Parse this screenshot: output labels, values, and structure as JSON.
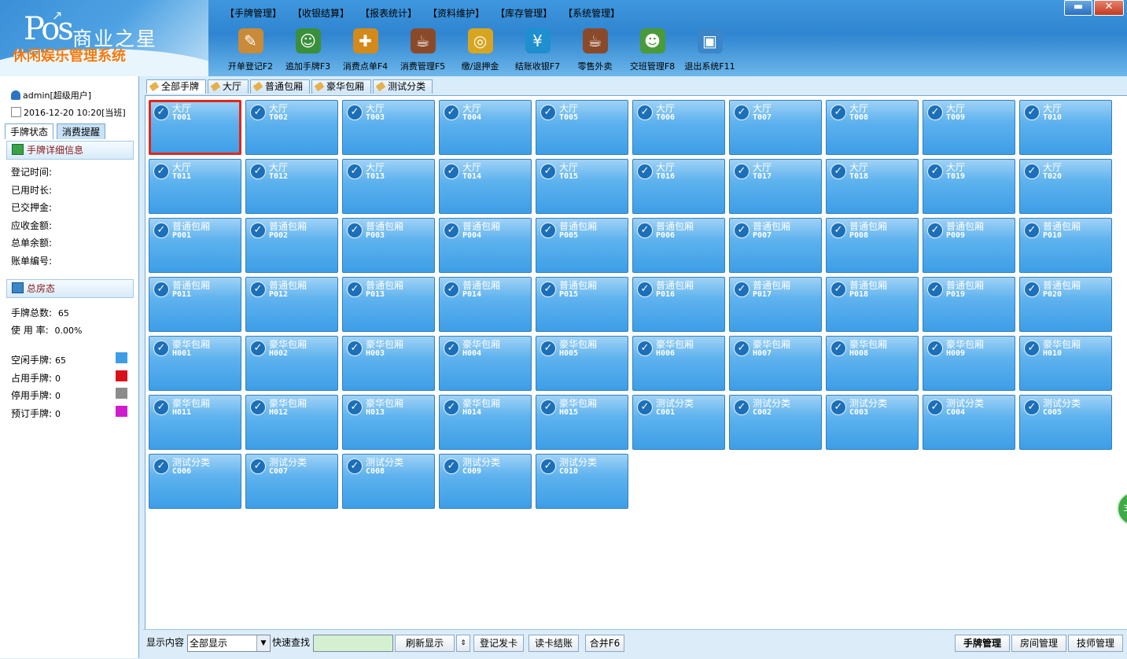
{
  "app": {
    "logo_text": "Pos",
    "brand": "商业之星",
    "subtitle": "休闲娱乐管理系统"
  },
  "menu": [
    "【手牌管理】",
    "【收银结算】",
    "【报表统计】",
    "【资料维护】",
    "【库存管理】",
    "【系统管理】"
  ],
  "toolbar": [
    {
      "label": "开单登记F2",
      "icon": "clipboard-icon",
      "color": "#c98a3a",
      "glyph": "✎"
    },
    {
      "label": "追加手牌F3",
      "icon": "user-icon",
      "color": "#3a8f3a",
      "glyph": "☺"
    },
    {
      "label": "消费点单F4",
      "icon": "cart-icon",
      "color": "#d48a1a",
      "glyph": "✚"
    },
    {
      "label": "消费管理F5",
      "icon": "coffee-cup-icon",
      "color": "#8a4a2a",
      "glyph": "☕"
    },
    {
      "label": "缴/退押金",
      "icon": "coins-icon",
      "color": "#d8a520",
      "glyph": "◎"
    },
    {
      "label": "结账收银F7",
      "icon": "yen-icon",
      "color": "#1f8fd0",
      "glyph": "¥"
    },
    {
      "label": "零售外卖",
      "icon": "coffee-cup-icon",
      "color": "#8a4a2a",
      "glyph": "☕"
    },
    {
      "label": "交班管理F8",
      "icon": "group-icon",
      "color": "#4a9a3a",
      "glyph": "☻"
    },
    {
      "label": "退出系统F11",
      "icon": "exit-window-icon",
      "color": "#3a86c8",
      "glyph": "▣"
    }
  ],
  "window_controls": {
    "minimize": "▬",
    "close": "✕"
  },
  "sidebar": {
    "user": "admin[超级用户]",
    "date": "2016-12-20 10:20[当班]",
    "tabs": [
      "手牌状态",
      "消费提醒"
    ],
    "detail_title": "手牌详细信息",
    "detail_fields": [
      "登记时间:",
      "已用时长:",
      "已交押金:",
      "应收金额:",
      "总单余额:",
      "账单编号:"
    ],
    "summary_title": "总房态",
    "total_label": "手牌总数:",
    "total_value": "65",
    "usage_label": "使 用 率:",
    "usage_value": "0.00%",
    "legend": [
      {
        "label": "空闲手牌:",
        "value": "65",
        "color": "#3d9ee6"
      },
      {
        "label": "占用手牌:",
        "value": "0",
        "color": "#d8121a"
      },
      {
        "label": "停用手牌:",
        "value": "0",
        "color": "#8c8c8c"
      },
      {
        "label": "预订手牌:",
        "value": "0",
        "color": "#d01ccf"
      }
    ]
  },
  "category_tabs": [
    "全部手牌",
    "大厅",
    "普通包厢",
    "豪华包厢",
    "测试分类"
  ],
  "cards": [
    {
      "cat": "大厅",
      "code": "T001"
    },
    {
      "cat": "大厅",
      "code": "T002"
    },
    {
      "cat": "大厅",
      "code": "T003"
    },
    {
      "cat": "大厅",
      "code": "T004"
    },
    {
      "cat": "大厅",
      "code": "T005"
    },
    {
      "cat": "大厅",
      "code": "T006"
    },
    {
      "cat": "大厅",
      "code": "T007"
    },
    {
      "cat": "大厅",
      "code": "T008"
    },
    {
      "cat": "大厅",
      "code": "T009"
    },
    {
      "cat": "大厅",
      "code": "T010"
    },
    {
      "cat": "大厅",
      "code": "T011"
    },
    {
      "cat": "大厅",
      "code": "T012"
    },
    {
      "cat": "大厅",
      "code": "T013"
    },
    {
      "cat": "大厅",
      "code": "T014"
    },
    {
      "cat": "大厅",
      "code": "T015"
    },
    {
      "cat": "大厅",
      "code": "T016"
    },
    {
      "cat": "大厅",
      "code": "T017"
    },
    {
      "cat": "大厅",
      "code": "T018"
    },
    {
      "cat": "大厅",
      "code": "T019"
    },
    {
      "cat": "大厅",
      "code": "T020"
    },
    {
      "cat": "普通包厢",
      "code": "P001"
    },
    {
      "cat": "普通包厢",
      "code": "P002"
    },
    {
      "cat": "普通包厢",
      "code": "P003"
    },
    {
      "cat": "普通包厢",
      "code": "P004"
    },
    {
      "cat": "普通包厢",
      "code": "P005"
    },
    {
      "cat": "普通包厢",
      "code": "P006"
    },
    {
      "cat": "普通包厢",
      "code": "P007"
    },
    {
      "cat": "普通包厢",
      "code": "P008"
    },
    {
      "cat": "普通包厢",
      "code": "P009"
    },
    {
      "cat": "普通包厢",
      "code": "P010"
    },
    {
      "cat": "普通包厢",
      "code": "P011"
    },
    {
      "cat": "普通包厢",
      "code": "P012"
    },
    {
      "cat": "普通包厢",
      "code": "P013"
    },
    {
      "cat": "普通包厢",
      "code": "P014"
    },
    {
      "cat": "普通包厢",
      "code": "P015"
    },
    {
      "cat": "普通包厢",
      "code": "P016"
    },
    {
      "cat": "普通包厢",
      "code": "P017"
    },
    {
      "cat": "普通包厢",
      "code": "P018"
    },
    {
      "cat": "普通包厢",
      "code": "P019"
    },
    {
      "cat": "普通包厢",
      "code": "P020"
    },
    {
      "cat": "豪华包厢",
      "code": "H001"
    },
    {
      "cat": "豪华包厢",
      "code": "H002"
    },
    {
      "cat": "豪华包厢",
      "code": "H003"
    },
    {
      "cat": "豪华包厢",
      "code": "H004"
    },
    {
      "cat": "豪华包厢",
      "code": "H005"
    },
    {
      "cat": "豪华包厢",
      "code": "H006"
    },
    {
      "cat": "豪华包厢",
      "code": "H007"
    },
    {
      "cat": "豪华包厢",
      "code": "H008"
    },
    {
      "cat": "豪华包厢",
      "code": "H009"
    },
    {
      "cat": "豪华包厢",
      "code": "H010"
    },
    {
      "cat": "豪华包厢",
      "code": "H011"
    },
    {
      "cat": "豪华包厢",
      "code": "H012"
    },
    {
      "cat": "豪华包厢",
      "code": "H013"
    },
    {
      "cat": "豪华包厢",
      "code": "H014"
    },
    {
      "cat": "豪华包厢",
      "code": "H015"
    },
    {
      "cat": "测试分类",
      "code": "C001"
    },
    {
      "cat": "测试分类",
      "code": "C002"
    },
    {
      "cat": "测试分类",
      "code": "C003"
    },
    {
      "cat": "测试分类",
      "code": "C004"
    },
    {
      "cat": "测试分类",
      "code": "C005"
    },
    {
      "cat": "测试分类",
      "code": "C006"
    },
    {
      "cat": "测试分类",
      "code": "C007"
    },
    {
      "cat": "测试分类",
      "code": "C008"
    },
    {
      "cat": "测试分类",
      "code": "C009"
    },
    {
      "cat": "测试分类",
      "code": "C010"
    }
  ],
  "selected_code": "T001",
  "statusbar": {
    "display_label": "显示内容",
    "display_value": "全部显示",
    "search_label": "快速查找",
    "search_value": "",
    "refresh": "刷新显示",
    "register_card": "登记发卡",
    "read_card": "读卡结账",
    "merge": "合并F6",
    "modes": [
      "手牌管理",
      "房间管理",
      "技师管理"
    ]
  },
  "side_circle_text": "3"
}
